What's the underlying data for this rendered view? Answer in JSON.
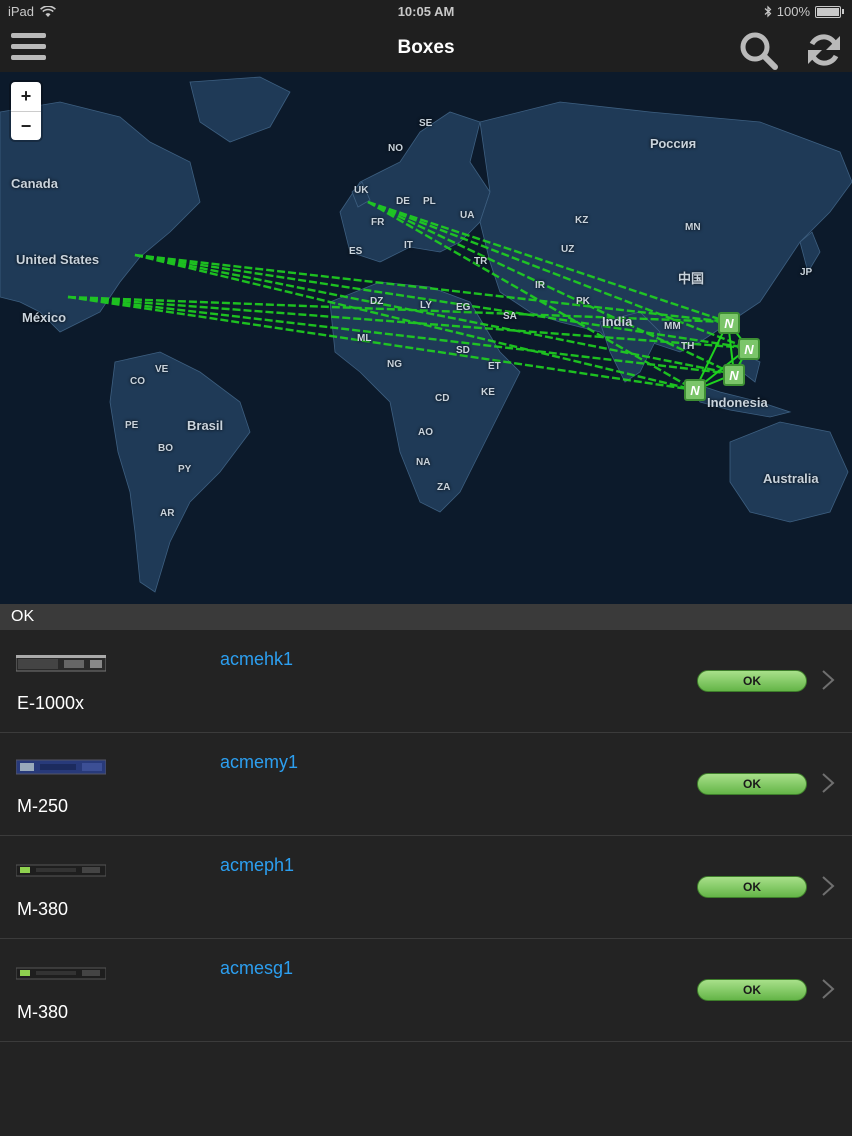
{
  "status_bar": {
    "carrier": "iPad",
    "time": "10:05 AM",
    "battery": "100%"
  },
  "nav": {
    "title": "Boxes"
  },
  "map": {
    "zoom_in": "+",
    "zoom_out": "−",
    "labels": {
      "canada": "Canada",
      "united_states": "United States",
      "mexico": "México",
      "brasil": "Brasil",
      "russia": "Россия",
      "china": "中国",
      "india": "India",
      "indonesia": "Indonesia",
      "australia": "Australia",
      "se": "SE",
      "no": "NO",
      "uk": "UK",
      "de": "DE",
      "pl": "PL",
      "ua": "UA",
      "fr": "FR",
      "es": "ES",
      "it": "IT",
      "tr": "TR",
      "kz": "KZ",
      "mn": "MN",
      "jp": "JP",
      "uz": "UZ",
      "ir": "IR",
      "pk": "PK",
      "mm": "MM",
      "th": "TH",
      "dz": "DZ",
      "ly": "LY",
      "eg": "EG",
      "sa": "SA",
      "ml": "ML",
      "sd": "SD",
      "ng": "NG",
      "et": "ET",
      "ke": "KE",
      "cd": "CD",
      "ao": "AO",
      "na": "NA",
      "za": "ZA",
      "co": "CO",
      "ve": "VE",
      "pe": "PE",
      "bo": "BO",
      "py": "PY",
      "ar": "AR"
    },
    "marker_glyph": "N"
  },
  "section": {
    "title": "OK"
  },
  "rows": [
    {
      "name": "acmehk1",
      "model": "E-1000x",
      "status": "OK"
    },
    {
      "name": "acmemy1",
      "model": "M-250",
      "status": "OK"
    },
    {
      "name": "acmeph1",
      "model": "M-380",
      "status": "OK"
    },
    {
      "name": "acmesg1",
      "model": "M-380",
      "status": "OK"
    }
  ],
  "colors": {
    "link": "#2c9ff0",
    "status_ok": "#7bc56a",
    "connection": "#1fd21f"
  },
  "icons": [
    "menu-icon",
    "search-icon",
    "refresh-icon",
    "chevron-right-icon",
    "wifi-icon",
    "bluetooth-icon",
    "battery-icon"
  ]
}
